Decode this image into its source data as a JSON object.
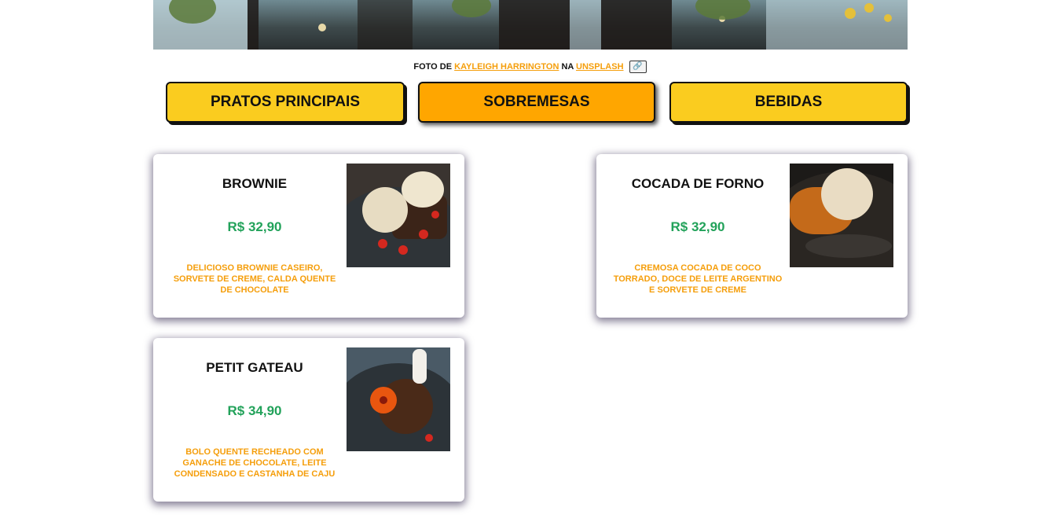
{
  "credit": {
    "prefix": "FOTO DE",
    "author": "KAYLEIGH HARRINGTON",
    "middle": "NA",
    "site": "UNSPLASH",
    "link_icon": "🔗"
  },
  "tabs": [
    {
      "label": "PRATOS PRINCIPAIS",
      "active": false
    },
    {
      "label": "SOBREMESAS",
      "active": true
    },
    {
      "label": "BEBIDAS",
      "active": false
    }
  ],
  "items": [
    {
      "name": "BROWNIE",
      "price": "R$ 32,90",
      "description": "DELICIOSO BROWNIE CASEIRO, SORVETE DE CREME, CALDA QUENTE DE CHOCOLATE"
    },
    {
      "name": "COCADA DE FORNO",
      "price": "R$ 32,90",
      "description": "CREMOSA COCADA DE COCO TORRADO, DOCE DE LEITE ARGENTINO E SORVETE DE CREME"
    },
    {
      "name": "PETIT GATEAU",
      "price": "R$ 34,90",
      "description": "BOLO QUENTE RECHEADO COM GANACHE DE CHOCOLATE, LEITE CONDENSADO E CASTANHA DE CAJU"
    }
  ],
  "colors": {
    "tab": "#facc1f",
    "tab_active": "#ffa600",
    "price": "#22a25a",
    "description": "#f59e0b",
    "link": "#f59e0b"
  }
}
